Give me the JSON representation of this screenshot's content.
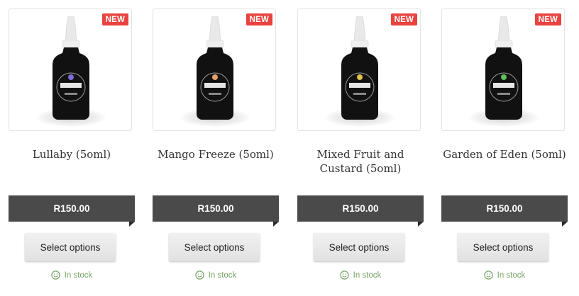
{
  "products": [
    {
      "badge": "NEW",
      "name": "Lullaby (5oml)",
      "price": "R150.00",
      "button": "Select options",
      "stock": "In stock",
      "label_color": "#7d6bd8"
    },
    {
      "badge": "NEW",
      "name": "Mango Freeze (5oml)",
      "price": "R150.00",
      "button": "Select options",
      "stock": "In stock",
      "label_color": "#e3a06a"
    },
    {
      "badge": "NEW",
      "name": "Mixed Fruit and Custard (5oml)",
      "price": "R150.00",
      "button": "Select options",
      "stock": "In stock",
      "label_color": "#e3c24a"
    },
    {
      "badge": "NEW",
      "name": "Garden of Eden (5oml)",
      "price": "R150.00",
      "button": "Select options",
      "stock": "In stock",
      "label_color": "#5fbf5a"
    }
  ],
  "colors": {
    "badge": "#e8433f",
    "price_bar": "#4a4a4a",
    "stock": "#77a464"
  },
  "icons": {
    "stock": "smiley-icon",
    "product_image": "bottle-icon"
  }
}
